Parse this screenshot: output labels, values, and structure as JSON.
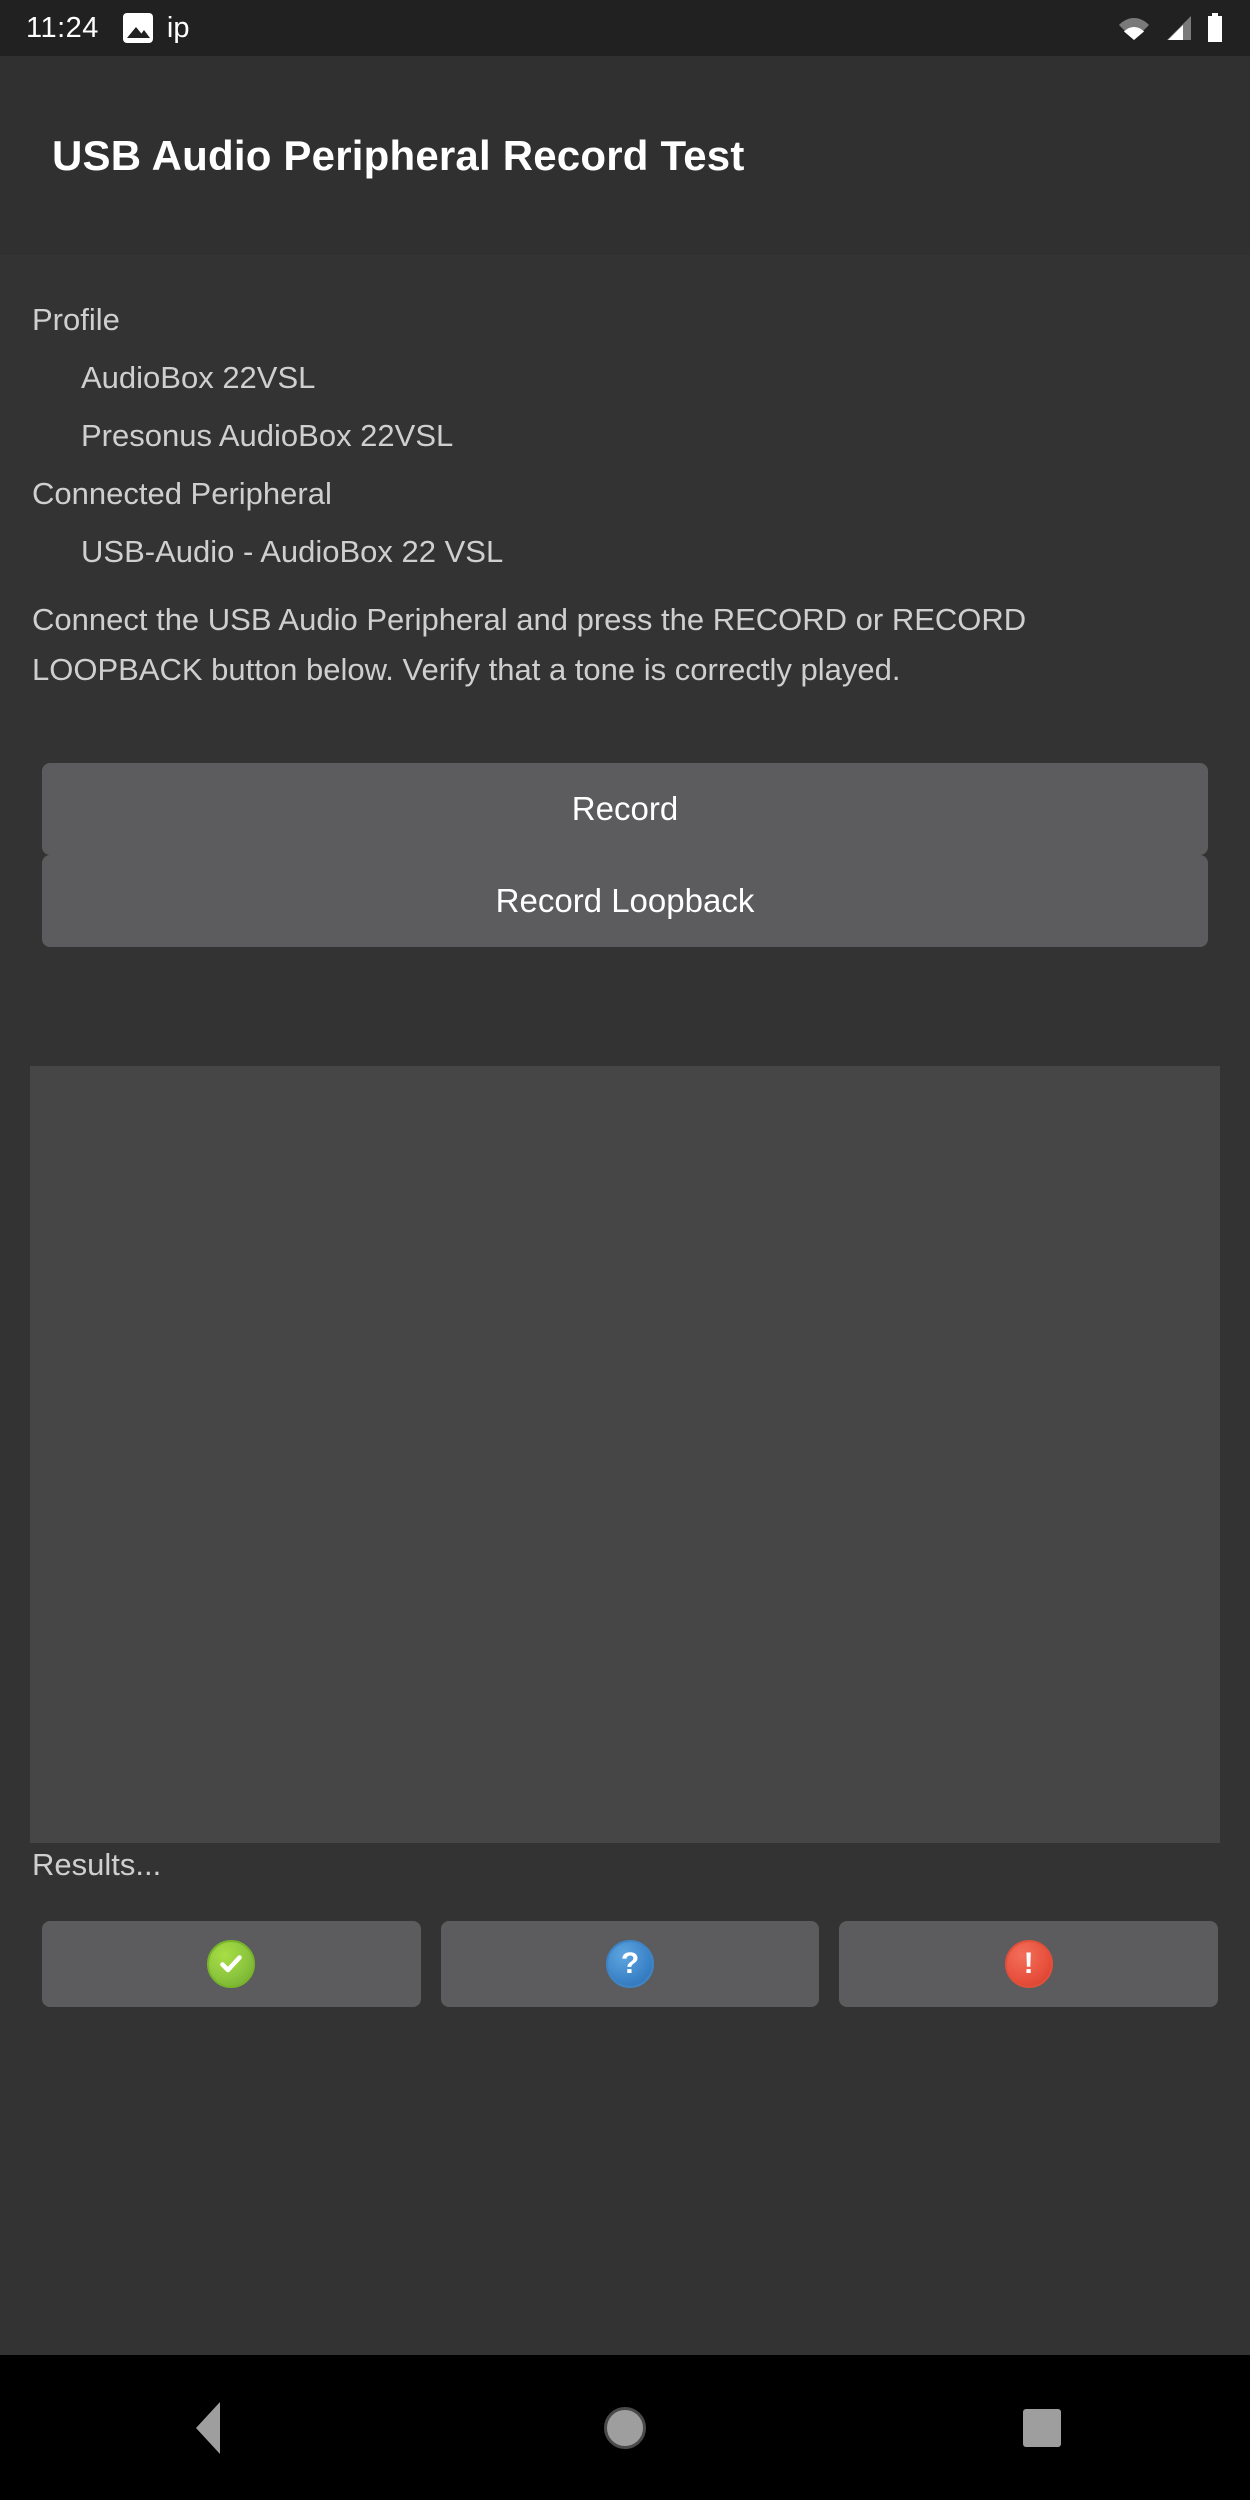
{
  "status_bar": {
    "time": "11:24",
    "notification_icons": [
      "image-icon"
    ],
    "notification_text": "ip",
    "right_icons": [
      "wifi-icon",
      "cellular-signal-icon",
      "battery-icon"
    ]
  },
  "app_bar": {
    "title": "USB Audio Peripheral Record Test"
  },
  "info": {
    "profile_label": "Profile",
    "profile_name": "AudioBox 22VSL",
    "profile_product": "Presonus AudioBox 22VSL",
    "connected_label": "Connected Peripheral",
    "connected_device": "USB-Audio - AudioBox 22 VSL"
  },
  "instructions": "Connect the USB Audio Peripheral and press the RECORD or RECORD LOOPBACK button below. Verify that a tone is correctly played.",
  "buttons": {
    "record": "Record",
    "record_loopback": "Record Loopback"
  },
  "results": {
    "panel_text": "",
    "label": "Results...",
    "actions": [
      {
        "name": "pass",
        "icon": "check-circle-icon",
        "color": "#8cc63e"
      },
      {
        "name": "info",
        "icon": "question-circle-icon",
        "color": "#3b84c8"
      },
      {
        "name": "fail",
        "icon": "exclamation-circle-icon",
        "color": "#e8503c"
      }
    ]
  },
  "nav_bar": {
    "back": "back-icon",
    "home": "home-icon",
    "recents": "recents-icon"
  },
  "colors": {
    "app_bar_bg": "#303030",
    "content_bg": "#333333",
    "button_bg": "#5c5c5e",
    "panel_bg": "#464646",
    "text_primary": "#ffffff",
    "text_secondary": "#cfcfcf",
    "nav_bg": "#000000"
  }
}
